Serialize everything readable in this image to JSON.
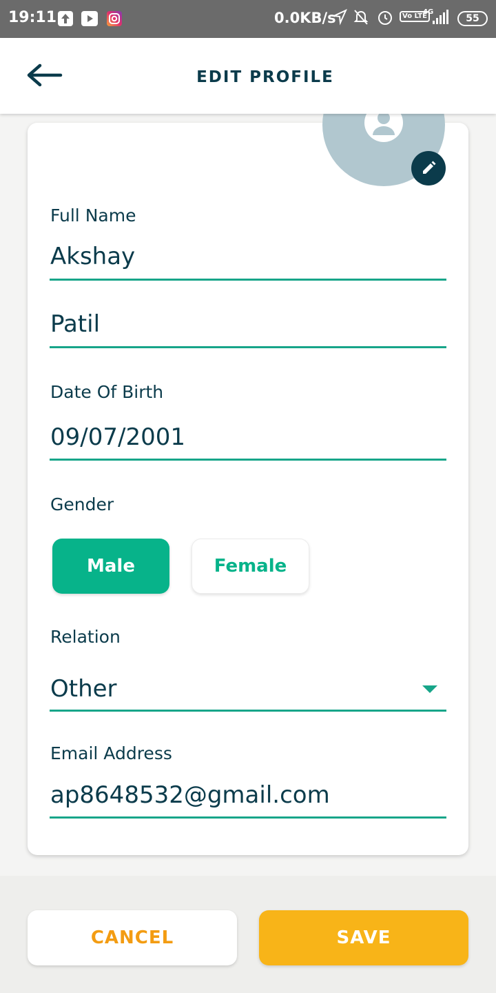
{
  "status_bar": {
    "time": "19:11",
    "network_speed": "0.0KB/s",
    "signal": "4G",
    "volte": "Vo LTE",
    "battery": "55",
    "icons": [
      "upload-icon",
      "youtube-icon",
      "instagram-icon",
      "location-icon",
      "bell-off-icon",
      "alarm-icon",
      "volte-icon",
      "signal-icon",
      "battery-icon"
    ]
  },
  "header": {
    "title": "EDIT PROFILE",
    "back_icon": "arrow-left-icon"
  },
  "profile": {
    "avatar_icon": "user-placeholder-icon",
    "edit_icon": "pencil-icon"
  },
  "form": {
    "full_name_label": "Full Name",
    "first_name": "Akshay",
    "last_name": "Patil",
    "dob_label": "Date Of Birth",
    "dob_value": "09/07/2001",
    "gender_label": "Gender",
    "gender_options": [
      "Male",
      "Female"
    ],
    "gender_selected": "Male",
    "relation_label": "Relation",
    "relation_value": "Other",
    "email_label": "Email Address",
    "email_value": "ap8648532@gmail.com"
  },
  "actions": {
    "cancel_label": "CANCEL",
    "save_label": "SAVE"
  },
  "colors": {
    "primary": "#0b3b4b",
    "accent_green": "#07b38a",
    "underline": "#17a589",
    "save_yellow": "#f8b418",
    "cancel_orange": "#f39c12"
  }
}
